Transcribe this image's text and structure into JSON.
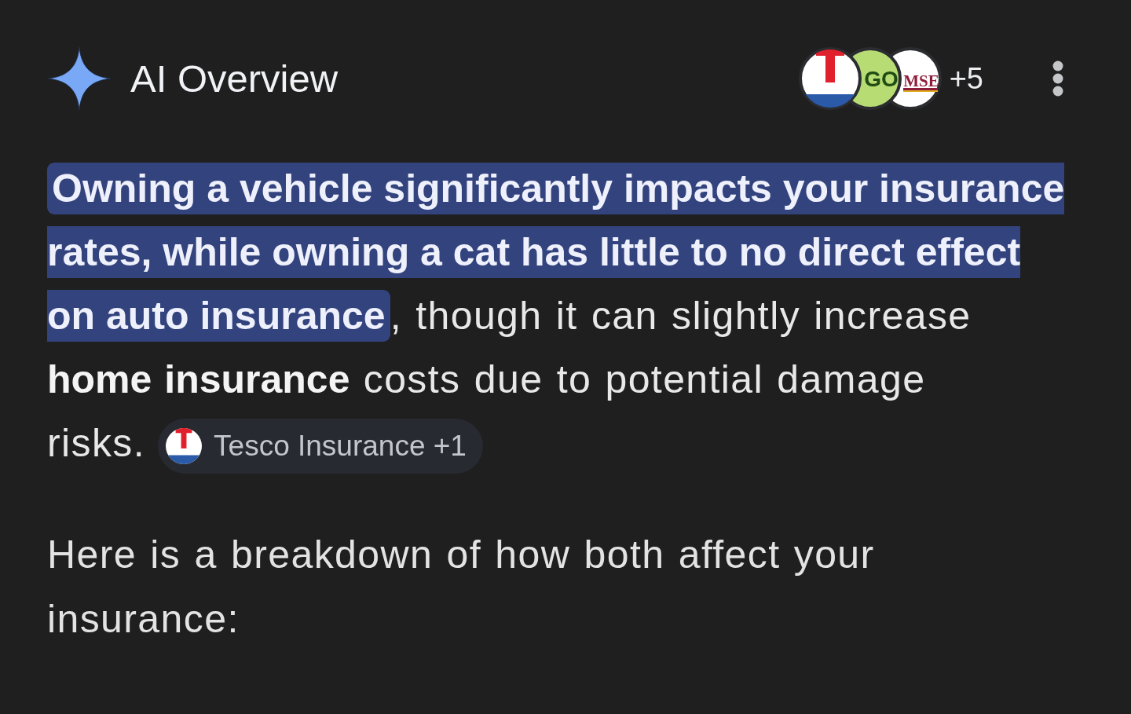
{
  "header": {
    "title": "AI Overview",
    "sources": [
      {
        "kind": "emblem"
      },
      {
        "kind": "green",
        "text": "GO",
        "color": "#b7dc74"
      },
      {
        "kind": "plain",
        "text": "MSE",
        "color": "#ffffff"
      }
    ],
    "more_sources": "+5"
  },
  "summary": {
    "segments": [
      {
        "text": "Owning a vehicle significantly impacts your insurance rates, while owning a cat has little to no direct effect on auto insurance",
        "highlighted": true
      },
      {
        "text": ", though it can slightly increase **home insurance** costs due to potential damage risks.",
        "highlighted": false
      }
    ],
    "citation": {
      "label": "Tesco Insurance +1"
    }
  },
  "intro": "Here is a breakdown of how both affect your insurance:"
}
